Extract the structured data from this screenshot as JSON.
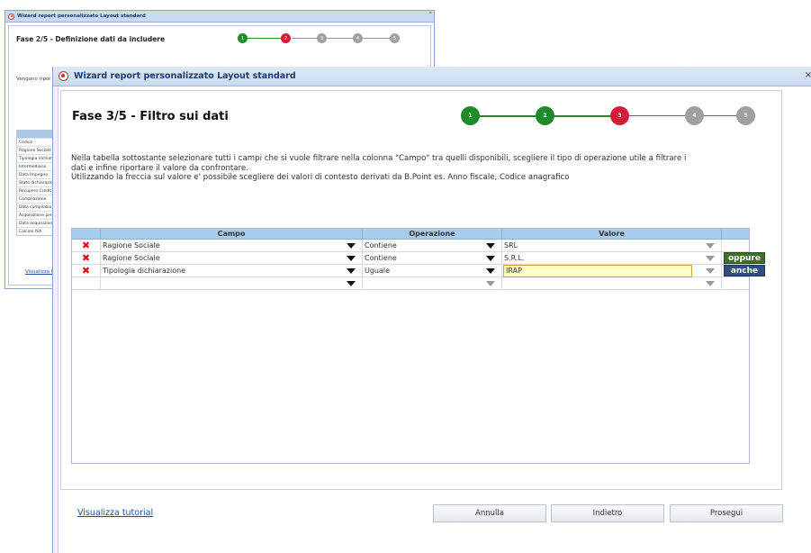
{
  "background_window": {
    "title": "Wizard report personalizzato Layout standard",
    "close_symbol": "˅",
    "step_title": "Fase 2/5 - Definizione dati da includere",
    "steps": [
      "1",
      "2",
      "3",
      "4",
      "5"
    ],
    "subtitle": "Vengono ripor",
    "list_items": [
      "Codice",
      "Ragione Sociale",
      "Tipologia dichiar",
      "Intermediario",
      "Data Impegno",
      "Stato dichiarazio",
      "Recupero Credit",
      "Compilazione",
      "Data compilazio",
      "Acquisizione pre",
      "Data acquisizion",
      "Calcolo ISA"
    ],
    "tutorial_link": "Visualizza tuto"
  },
  "window": {
    "title": "Wizard report personalizzato Layout standard",
    "close_symbol": "×"
  },
  "step_title": "Fase 3/5 - Filtro sui dati",
  "stepper": {
    "steps": [
      {
        "label": "1",
        "status": "done",
        "color": "#1f8a2a"
      },
      {
        "label": "2",
        "status": "done",
        "color": "#1f8a2a"
      },
      {
        "label": "3",
        "status": "current",
        "color": "#d21d3a"
      },
      {
        "label": "4",
        "status": "pending",
        "color": "#a0a0a0"
      },
      {
        "label": "5",
        "status": "pending",
        "color": "#a0a0a0"
      }
    ]
  },
  "instructions": {
    "line1": "Nella tabella sottostante selezionare tutti i campi che si vuole filtrare nella colonna \"Campo\" tra quelli disponibili, scegliere il tipo di operazione utile a filtrare i",
    "line2": "dati e infine riportare il valore da confrontare.",
    "line3": "Utilizzando la freccia sul valore e' possibile scegliere dei valori di contesto derivati da B.Point es. Anno fiscale, Codice anagrafico"
  },
  "grid": {
    "columns": {
      "campo": "Campo",
      "operazione": "Operazione",
      "valore": "Valore"
    },
    "rows": [
      {
        "campo": "Ragione Sociale",
        "operazione": "Contiene",
        "valore": "SRL",
        "extra": ""
      },
      {
        "campo": "Ragione Sociale",
        "operazione": "Contiene",
        "valore": "S.R.L.",
        "extra": "oppure"
      },
      {
        "campo": "Tipologia dichiarazione",
        "operazione": "Uguale",
        "valore": "IRAP",
        "extra": "anche"
      },
      {
        "campo": "",
        "operazione": "",
        "valore": "",
        "extra": ""
      }
    ],
    "delete_icon": "✖"
  },
  "footer": {
    "tutorial_link": "Visualizza tutorial",
    "cancel_label": "Annulla",
    "back_label": "Indietro",
    "next_label": "Prosegui"
  }
}
